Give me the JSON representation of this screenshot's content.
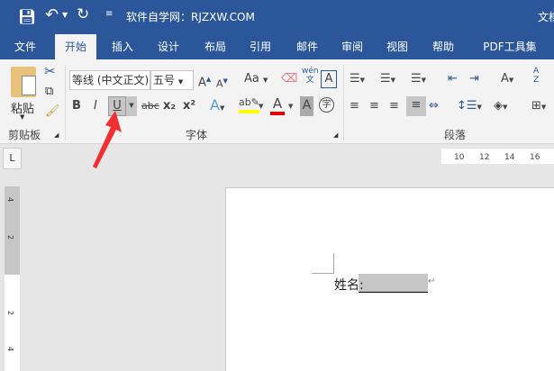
{
  "title_bar": {
    "doc_title": "软件自学网：RJZXW.COM",
    "right_text": "文档"
  },
  "tabs": [
    "文件",
    "开始",
    "插入",
    "设计",
    "布局",
    "引用",
    "邮件",
    "审阅",
    "视图",
    "帮助",
    "PDF工具集"
  ],
  "active_tab": "开始",
  "clipboard": {
    "paste_label": "粘贴",
    "group_label": "剪贴板"
  },
  "font": {
    "font_name": "等线 (中文正文)",
    "font_size": "五号",
    "case_label": "Aa",
    "phonetic_label": "wén",
    "phonetic_sub": "文",
    "bold": "B",
    "italic": "I",
    "underline": "U",
    "strike": "abc",
    "subscript": "x₂",
    "superscript": "x²",
    "font_color_letter": "A",
    "enclose_label": "字",
    "group_label": "字体",
    "highlight_color": "#ffff00",
    "font_color": "#e00000"
  },
  "paragraph": {
    "group_label": "段落"
  },
  "ruler": {
    "horizontal": [
      "10",
      "12",
      "14",
      "16"
    ],
    "vertical": [
      "4",
      "2",
      "2",
      "4"
    ],
    "tab_selector": "L"
  },
  "document": {
    "text": "姓名:"
  },
  "colors": {
    "brand": "#2b579a",
    "arrow": "#f03030"
  }
}
